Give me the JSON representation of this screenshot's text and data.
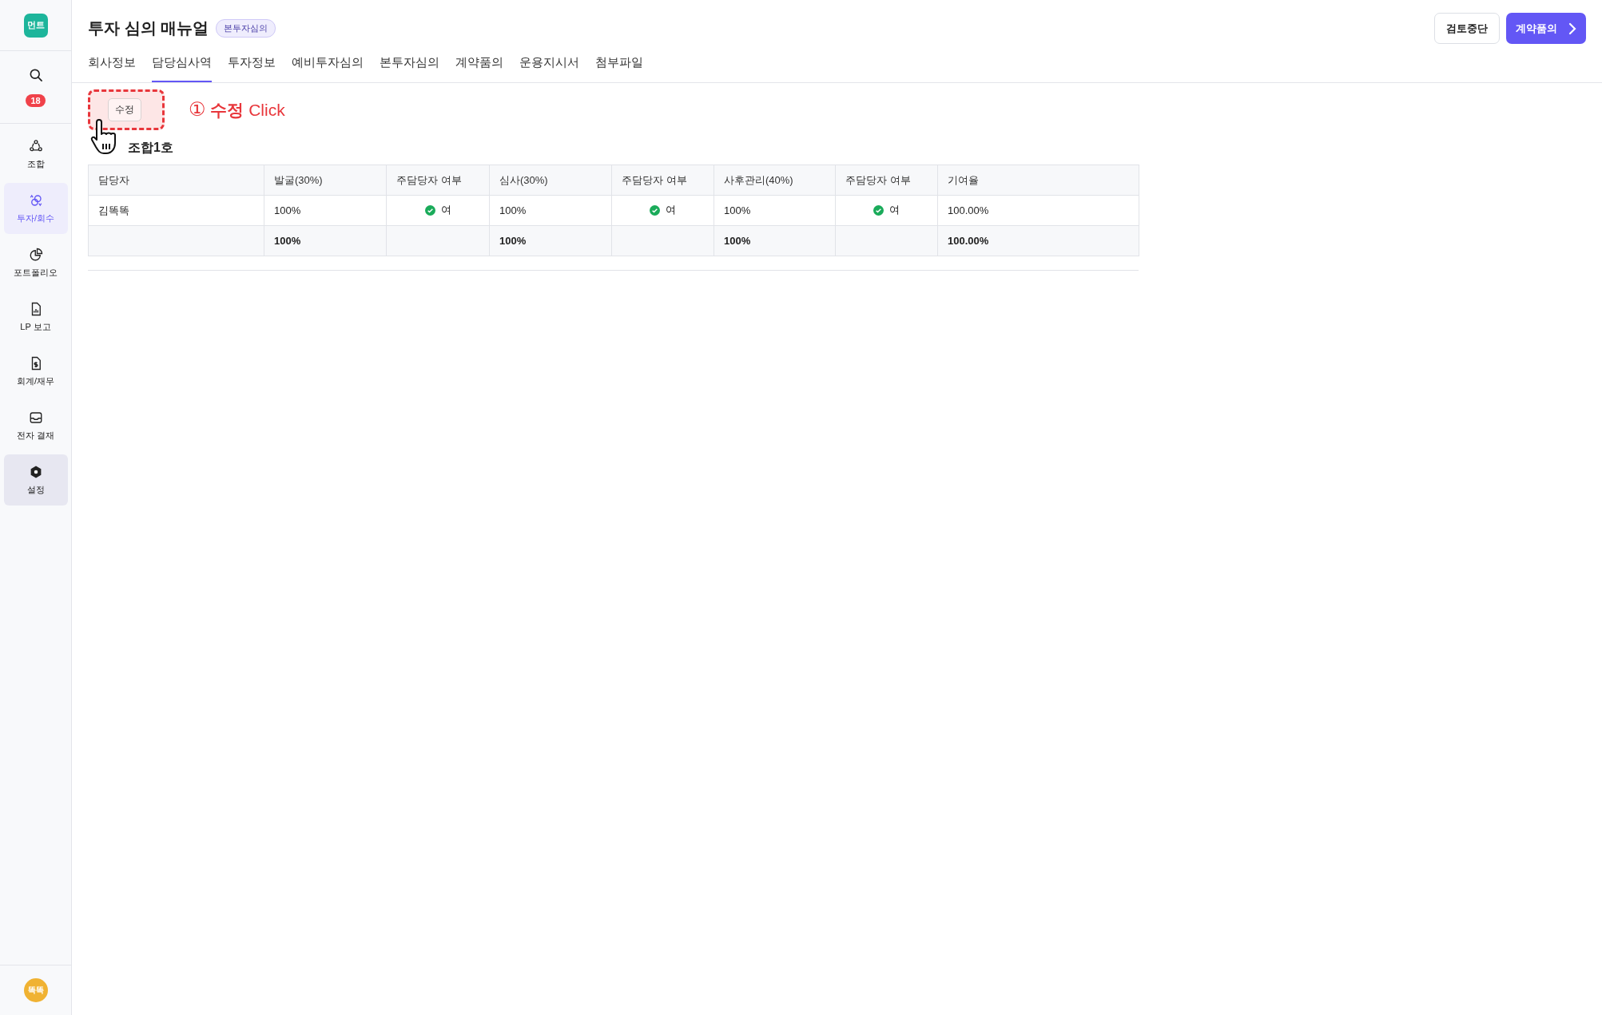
{
  "sidebar": {
    "logo": "먼트",
    "badge": "18",
    "items": [
      {
        "kind": "team",
        "label": "조합",
        "selected": false,
        "hovered": false
      },
      {
        "kind": "coins",
        "label": "투자/회수",
        "selected": true,
        "hovered": false
      },
      {
        "kind": "pie",
        "label": "포트폴리오",
        "selected": false,
        "hovered": false
      },
      {
        "kind": "report",
        "label": "LP 보고",
        "selected": false,
        "hovered": false
      },
      {
        "kind": "dollar",
        "label": "회계/재무",
        "selected": false,
        "hovered": false
      },
      {
        "kind": "inbox",
        "label": "전자 결재",
        "selected": false,
        "hovered": false
      },
      {
        "kind": "gear",
        "label": "설정",
        "selected": false,
        "hovered": true
      }
    ],
    "avatar": "똑똑"
  },
  "header": {
    "title": "투자 심의 매뉴얼",
    "stage_badge": "본투자심의",
    "buttons": [
      {
        "kind": "outline",
        "label": "검토중단"
      },
      {
        "kind": "primary",
        "label": "계약품의"
      }
    ]
  },
  "tabs": [
    {
      "label": "회사정보",
      "selected": false
    },
    {
      "label": "담당심사역",
      "selected": true
    },
    {
      "label": "투자정보",
      "selected": false
    },
    {
      "label": "예비투자심의",
      "selected": false
    },
    {
      "label": "본투자심의",
      "selected": false
    },
    {
      "label": "계약품의",
      "selected": false
    },
    {
      "label": "운용지시서",
      "selected": false
    },
    {
      "label": "첨부파일",
      "selected": false
    }
  ],
  "edit_button": "수정",
  "annotation": {
    "step": "①",
    "text": "**수정** Click"
  },
  "section_title": "조합1호",
  "table": {
    "columns": [
      "담당자",
      "발굴(30%)",
      "주담당자 여부",
      "심사(30%)",
      "주담당자 여부",
      "사후관리(40%)",
      "주담당자 여부",
      "기여율"
    ],
    "rows": [
      {
        "kind": "body",
        "cells": [
          {
            "kind": "text",
            "text": "김똑똑"
          },
          {
            "kind": "text",
            "text": "100%"
          },
          {
            "kind": "check",
            "checked": true,
            "text": "여"
          },
          {
            "kind": "text",
            "text": "100%"
          },
          {
            "kind": "check",
            "checked": true,
            "text": "여"
          },
          {
            "kind": "text",
            "text": "100%"
          },
          {
            "kind": "check",
            "checked": true,
            "text": "여"
          },
          {
            "kind": "text",
            "text": "100.00%"
          }
        ]
      },
      {
        "kind": "total",
        "cells": [
          {
            "kind": "empty"
          },
          {
            "kind": "text",
            "text": "100%"
          },
          {
            "kind": "empty"
          },
          {
            "kind": "text",
            "text": "100%"
          },
          {
            "kind": "empty"
          },
          {
            "kind": "text",
            "text": "100%"
          },
          {
            "kind": "empty"
          },
          {
            "kind": "text",
            "text": "100.00%"
          }
        ]
      }
    ]
  }
}
